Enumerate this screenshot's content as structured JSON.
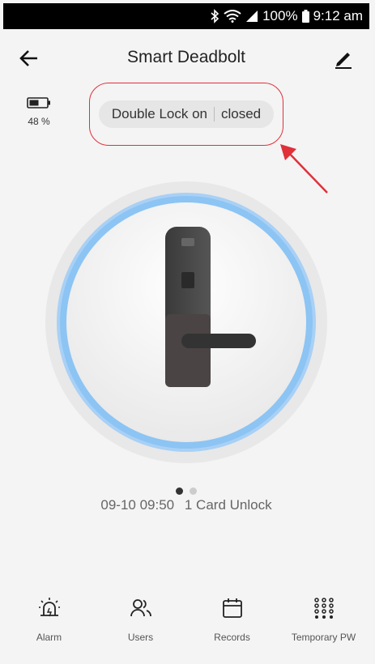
{
  "status_bar": {
    "battery": "100%",
    "time": "9:12 am"
  },
  "header": {
    "title": "Smart Deadbolt"
  },
  "battery": {
    "percent": "48 %"
  },
  "lock_status": {
    "double_lock": "Double Lock on",
    "state": "closed"
  },
  "pagination": {
    "pages": 2,
    "active": 1
  },
  "last_event": {
    "time": "09-10 09:50",
    "description": "1 Card Unlock"
  },
  "bottom_nav": {
    "items": [
      {
        "label": "Alarm",
        "icon": "alarm-icon"
      },
      {
        "label": "Users",
        "icon": "users-icon"
      },
      {
        "label": "Records",
        "icon": "calendar-icon"
      },
      {
        "label": "Temporary PW",
        "icon": "keypad-icon"
      }
    ]
  },
  "colors": {
    "annotation": "#e0303a",
    "ring": "#8cc4f4"
  }
}
